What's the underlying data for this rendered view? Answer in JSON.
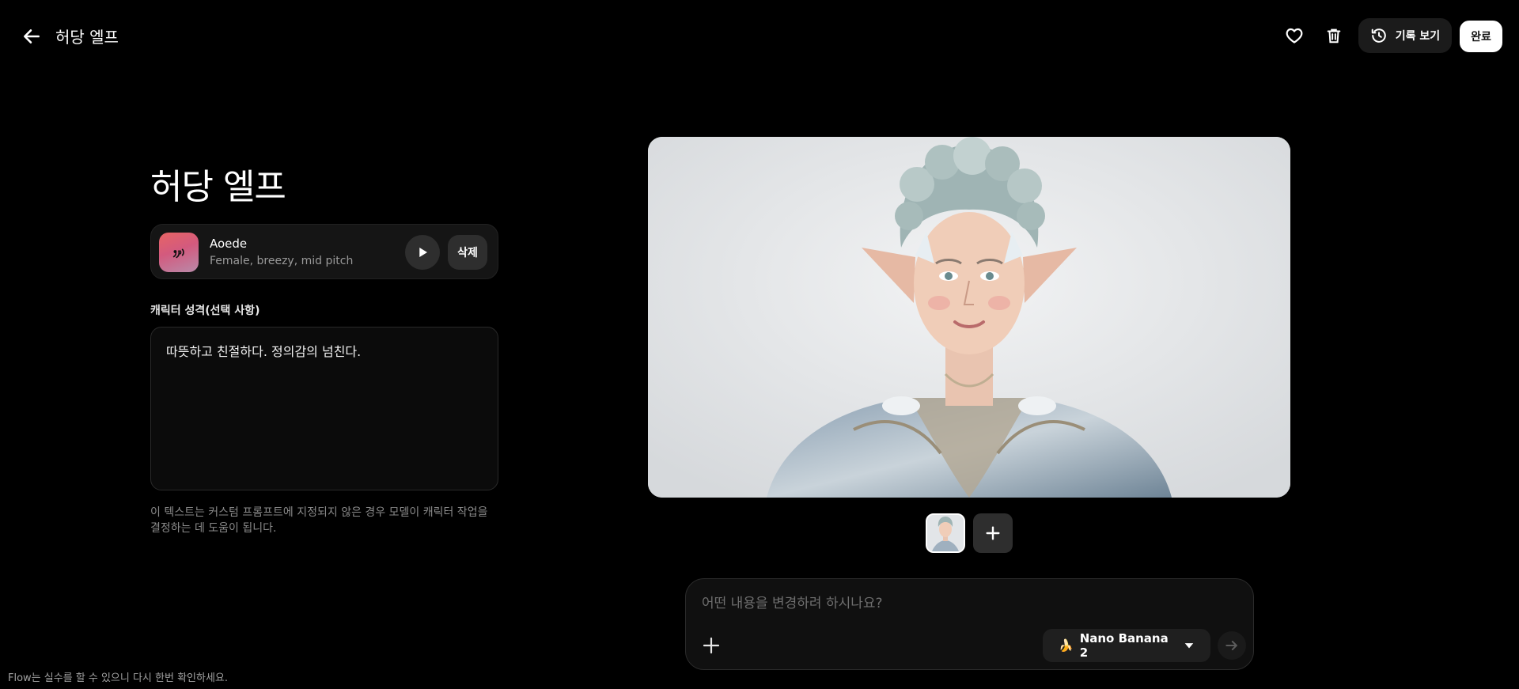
{
  "header": {
    "title": "허당 엘프",
    "history_label": "기록 보기",
    "done_label": "완료"
  },
  "character": {
    "name": "허당 엘프",
    "voice": {
      "name": "Aoede",
      "description": "Female, breezy, mid pitch",
      "delete_label": "삭제"
    },
    "persona_label": "캐릭터 성격(선택 사항)",
    "persona_text": "따뜻하고 친절하다. 정의감의 넘친다.",
    "helper_text": "이 텍스트는 커스텀 프롬프트에 지정되지 않은 경우 모델이 캐릭터 작업을 결정하는 데 도움이 됩니다."
  },
  "prompt": {
    "placeholder": "어떤 내용을 변경하려 하시나요?",
    "model_emoji": "🍌",
    "model_label": "Nano Banana 2"
  },
  "footer": {
    "note": "Flow는 실수를 할 수 있으니 다시 한번 확인하세요."
  },
  "icons": {
    "back": "arrow-left-icon",
    "favorite": "heart-icon",
    "delete": "trash-icon",
    "history": "history-icon",
    "voice": "voice-wave-icon",
    "play": "play-icon",
    "add": "plus-icon",
    "dropdown": "caret-down-icon",
    "send": "arrow-right-icon"
  },
  "colors": {
    "background": "#000000",
    "card": "#151515",
    "accent_avatar": "#e86464"
  }
}
